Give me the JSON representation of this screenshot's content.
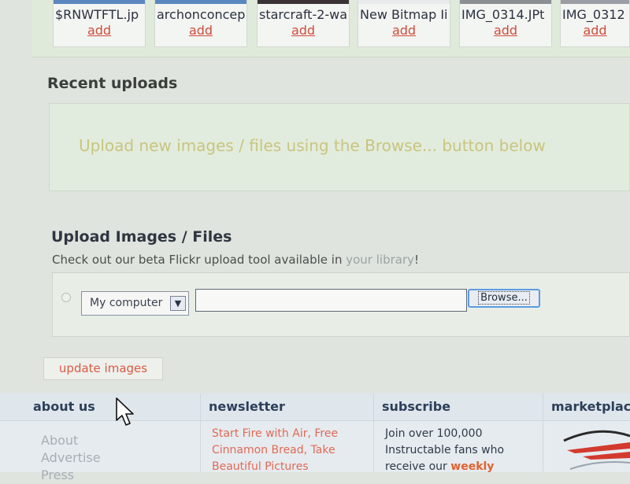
{
  "library": {
    "thumbnails": [
      {
        "name": "$RNWTFTL.jp",
        "add_label": "add"
      },
      {
        "name": "archonconcep",
        "add_label": "add"
      },
      {
        "name": "starcraft-2-wa",
        "add_label": "add"
      },
      {
        "name": "New Bitmap Ii",
        "add_label": "add"
      },
      {
        "name": "IMG_0314.JPt",
        "add_label": "add"
      },
      {
        "name": "IMG_0312",
        "add_label": "add"
      }
    ]
  },
  "recent": {
    "title": "Recent uploads",
    "hint": "Upload new images / files using the Browse... button below"
  },
  "upload": {
    "title": "Upload Images / Files",
    "subtitle_prefix": "Check out our beta Flickr upload tool available in ",
    "library_link": "your library",
    "subtitle_suffix": "!",
    "source_value": "My computer",
    "file_value": "",
    "browse_label": "Browse..."
  },
  "update_label": "update images",
  "footer": {
    "about": {
      "heading": "about us",
      "links": [
        "About",
        "Advertise",
        "Press"
      ]
    },
    "newsletter": {
      "heading": "newsletter",
      "text": "Start Fire with Air, Free Cinnamon Bread, Take Beautiful Pictures"
    },
    "subscribe": {
      "heading": "subscribe",
      "text_prefix": "Join over 100,000 Instructable fans who receive our ",
      "text_highlight": "weekly"
    },
    "marketplace": {
      "heading": "marketplace"
    }
  },
  "colors": {
    "add_link": "#d04b3c",
    "hint_text": "#c9c47e",
    "update_text": "#d95b43",
    "footer_heading": "#2c3f5a",
    "newsletter_text": "#e06a56",
    "browse_focus": "#5d9be0"
  },
  "icons": {
    "dropdown": "chevron-down-icon",
    "pointer": "mouse-cursor-icon",
    "logo": "marketplace-logo"
  }
}
